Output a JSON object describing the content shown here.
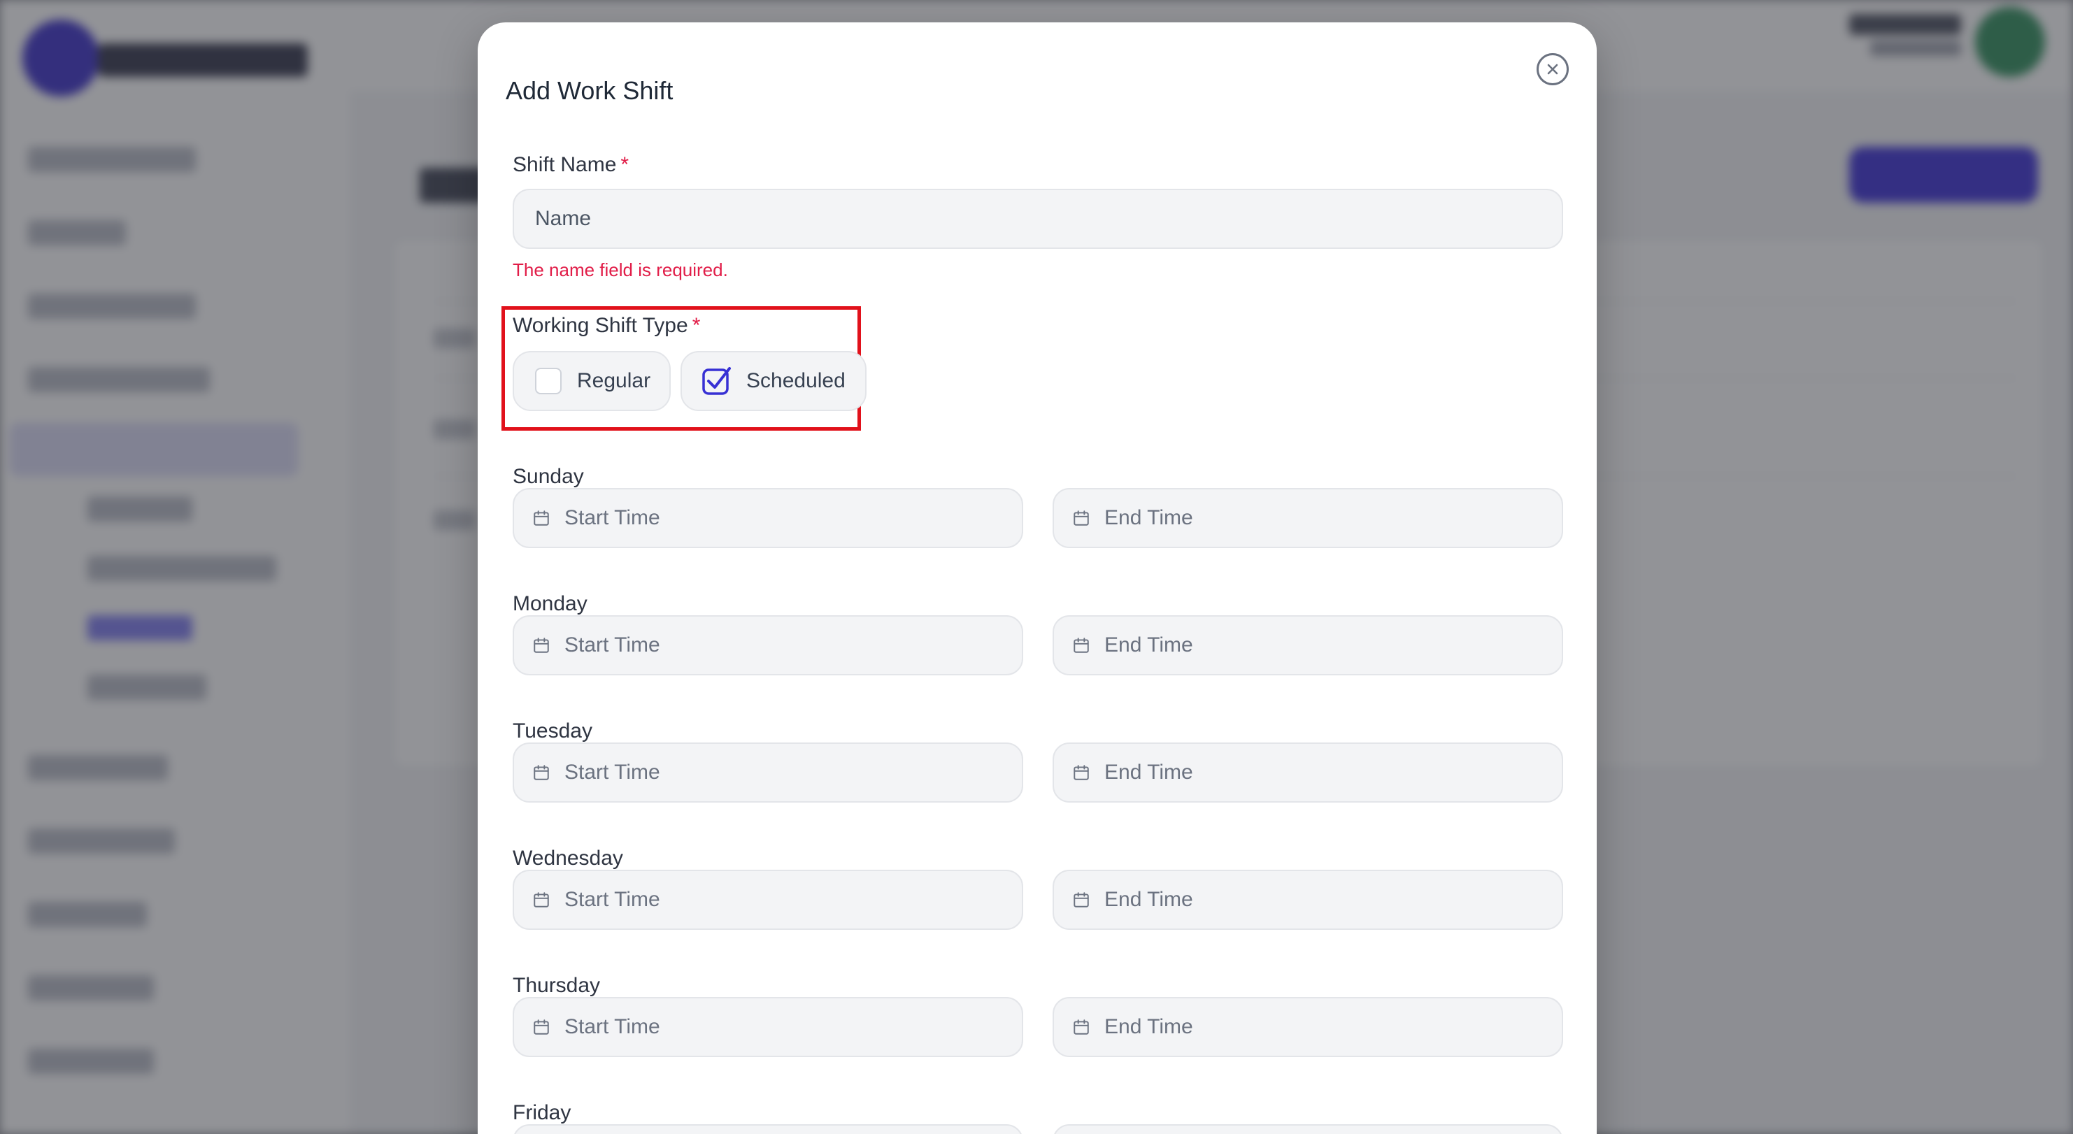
{
  "modal": {
    "title": "Add Work Shift"
  },
  "shift_name": {
    "label": "Shift Name",
    "required_mark": "*",
    "placeholder": "Name",
    "value": "",
    "error": "The name field is required."
  },
  "shift_type": {
    "label": "Working Shift Type",
    "required_mark": "*",
    "options": [
      {
        "label": "Regular",
        "checked": false
      },
      {
        "label": "Scheduled",
        "checked": true
      }
    ]
  },
  "schedule": {
    "start_placeholder": "Start Time",
    "end_placeholder": "End Time",
    "days": [
      {
        "name": "Sunday"
      },
      {
        "name": "Monday"
      },
      {
        "name": "Tuesday"
      },
      {
        "name": "Wednesday"
      },
      {
        "name": "Thursday"
      },
      {
        "name": "Friday"
      }
    ]
  },
  "colors": {
    "accent": "#3730d4",
    "error": "#e11d48",
    "highlight": "#e1111b",
    "field_bg": "#f3f4f6"
  }
}
